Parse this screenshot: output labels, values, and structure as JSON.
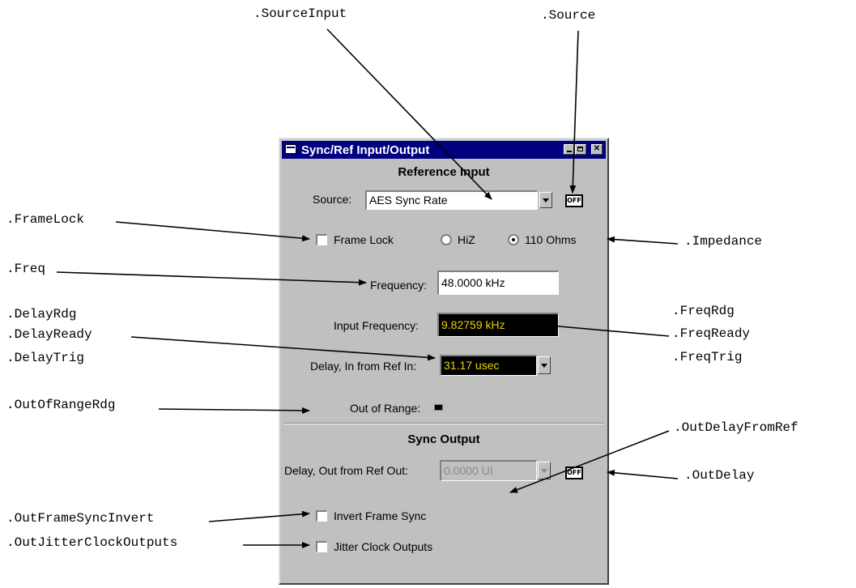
{
  "window": {
    "title": "Sync/Ref Input/Output",
    "close_glyph": "✕"
  },
  "reference_input": {
    "heading": "Reference Input",
    "source_label": "Source:",
    "source_value": "AES Sync Rate",
    "source_off_label": "OFF",
    "frame_lock_label": "Frame Lock",
    "frame_lock_checked": false,
    "impedance_options": [
      {
        "label": "HiZ",
        "selected": false
      },
      {
        "label": "110 Ohms",
        "selected": true
      }
    ],
    "frequency_label": "Frequency:",
    "frequency_value": "48.0000 kHz",
    "input_frequency_label": "Input Frequency:",
    "input_frequency_value": "9.82759 kHz",
    "delay_label": "Delay, In from Ref In:",
    "delay_value": "31.17  usec",
    "out_of_range_label": "Out of Range:"
  },
  "sync_output": {
    "heading": "Sync Output",
    "delay_label": "Delay, Out from Ref Out:",
    "delay_value": "0.0000  UI",
    "delay_off_label": "OFF",
    "invert_frame_sync_label": "Invert Frame Sync",
    "jitter_clock_outputs_label": "Jitter Clock Outputs"
  },
  "annotations": {
    "source_input": ".SourceInput",
    "source": ".Source",
    "frame_lock": ".FrameLock",
    "impedance": ".Impedance",
    "freq": ".Freq",
    "delay_rdg": ".DelayRdg",
    "delay_ready": ".DelayReady",
    "delay_trig": ".DelayTrig",
    "freq_rdg": ".FreqRdg",
    "freq_ready": ".FreqReady",
    "freq_trig": ".FreqTrig",
    "out_of_range_rdg": ".OutOfRangeRdg",
    "out_delay_from_ref": ".OutDelayFromRef",
    "out_delay": ".OutDelay",
    "out_frame_sync_invert": ".OutFrameSyncInvert",
    "out_jitter_clock_outputs": ".OutJitterClockOutputs"
  },
  "colors": {
    "title_bar": "#000080",
    "reading_text": "#e8d400",
    "reading_bg": "#000000",
    "panel": "#c0c0c0"
  }
}
